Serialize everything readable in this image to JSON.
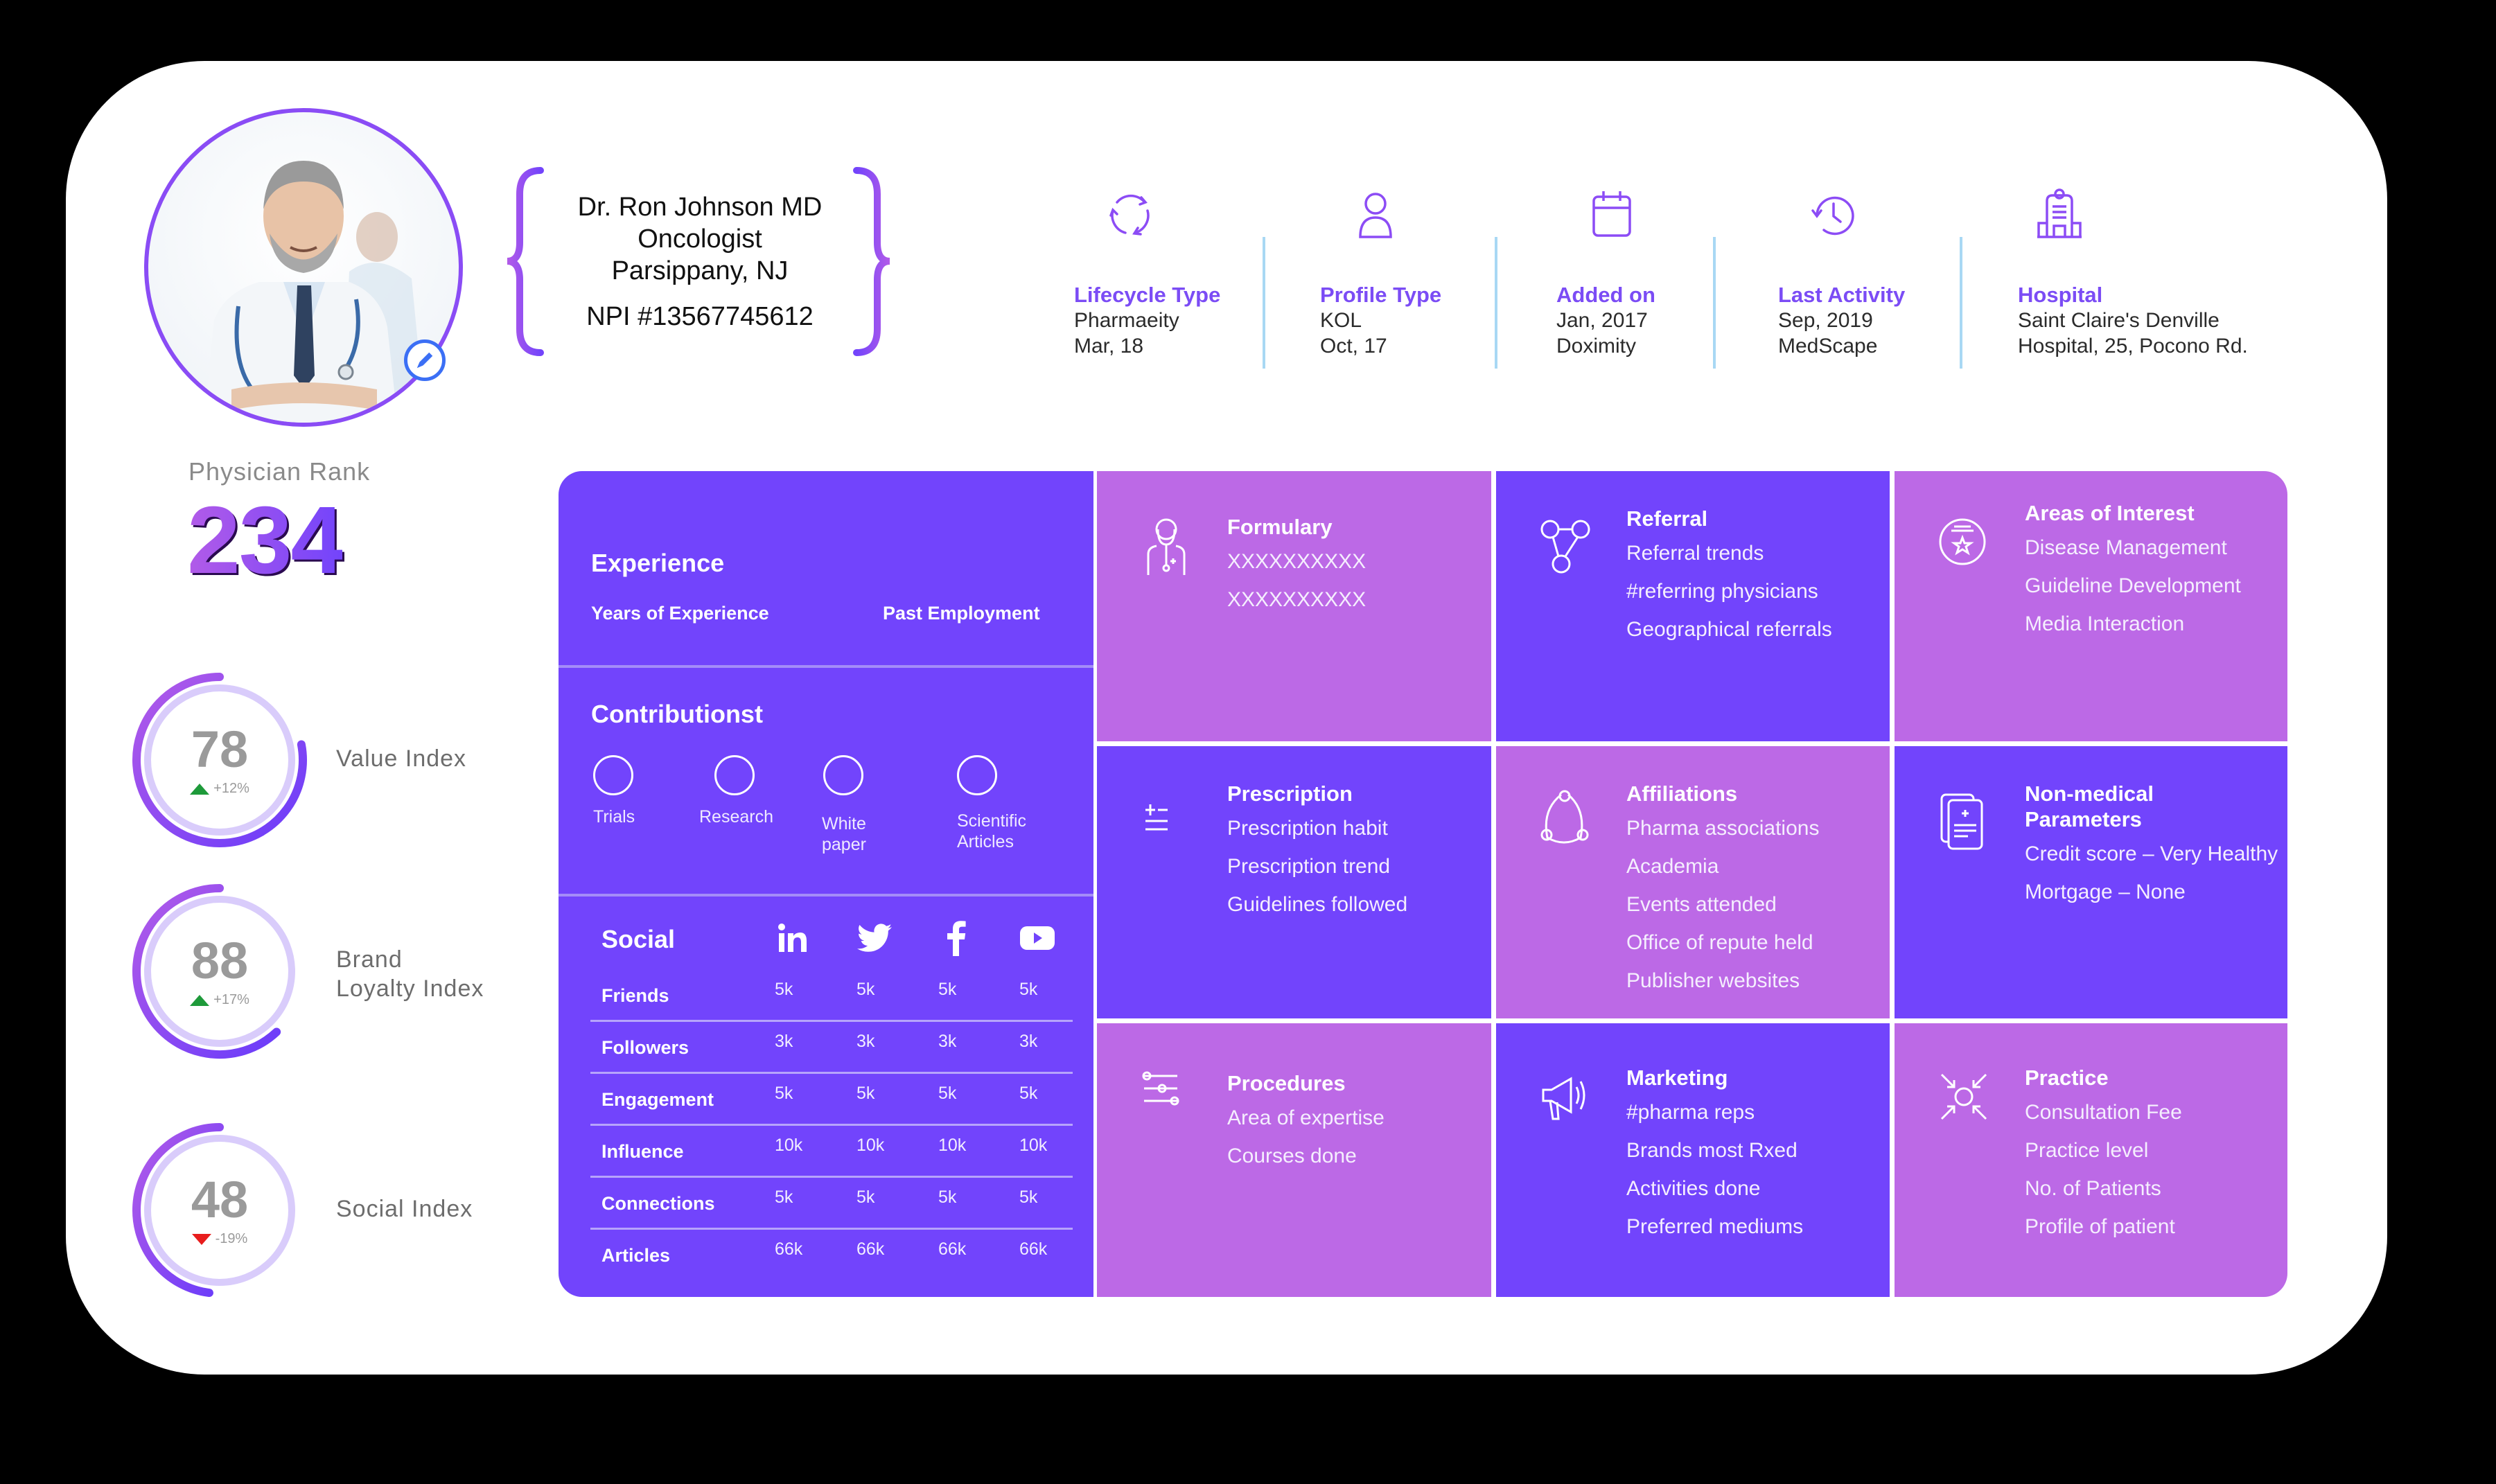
{
  "colors": {
    "primary": "#7244FC",
    "secondary": "#BC69E6",
    "accent_text": "#7B4CF5",
    "divider": "#A8D8F4",
    "up": "#1E9A3A",
    "down": "#E81D1D"
  },
  "profile": {
    "name": "Dr. Ron Johnson MD",
    "specialty": "Oncologist",
    "location": "Parsippany, NJ",
    "npi": "NPI #13567745612",
    "edit_icon": "pencil-icon"
  },
  "info": [
    {
      "icon": "cycle-icon",
      "label": "Lifecycle Type",
      "line1": "Pharmaeity",
      "line2": "Mar, 18"
    },
    {
      "icon": "user-icon",
      "label": "Profile Type",
      "line1": "KOL",
      "line2": "Oct, 17"
    },
    {
      "icon": "calendar-icon",
      "label": "Added on",
      "line1": "Jan, 2017",
      "line2": "Doximity"
    },
    {
      "icon": "history-clock-icon",
      "label": "Last Activity",
      "line1": "Sep, 2019",
      "line2": "MedScape"
    },
    {
      "icon": "hospital-icon",
      "label": "Hospital",
      "line1": "Saint Claire's Denville",
      "line2": "Hospital, 25, Pocono Rd."
    }
  ],
  "rank": {
    "label": "Physician Rank",
    "value": "234"
  },
  "indices": [
    {
      "value": "78",
      "delta": "+12%",
      "direction": "up",
      "label1": "Value Index",
      "label2": "",
      "fill": 0.78
    },
    {
      "value": "88",
      "delta": "+17%",
      "direction": "up",
      "label1": "Brand",
      "label2": "Loyalty Index",
      "fill": 0.62
    },
    {
      "value": "48",
      "delta": "-19%",
      "direction": "down",
      "label1": "Social Index",
      "label2": "",
      "fill": 0.48
    }
  ],
  "experience": {
    "title": "Experience",
    "col1": "Years of Experience",
    "col2": "Past Employment"
  },
  "contributions": {
    "title": "Contributionst",
    "items": [
      {
        "l1": "Trials",
        "l2": ""
      },
      {
        "l1": "Research",
        "l2": ""
      },
      {
        "l1": "White",
        "l2": "paper"
      },
      {
        "l1": "Scientific",
        "l2": "Articles"
      }
    ]
  },
  "social": {
    "title": "Social",
    "networks": [
      "linkedin-icon",
      "twitter-icon",
      "facebook-icon",
      "youtube-icon"
    ],
    "rows": [
      {
        "label": "Friends",
        "values": [
          "5k",
          "5k",
          "5k",
          "5k"
        ]
      },
      {
        "label": "Followers",
        "values": [
          "3k",
          "3k",
          "3k",
          "3k"
        ]
      },
      {
        "label": "Engagement",
        "values": [
          "5k",
          "5k",
          "5k",
          "5k"
        ]
      },
      {
        "label": "Influence",
        "values": [
          "10k",
          "10k",
          "10k",
          "10k"
        ]
      },
      {
        "label": "Connections",
        "values": [
          "5k",
          "5k",
          "5k",
          "5k"
        ]
      },
      {
        "label": "Articles",
        "values": [
          "66k",
          "66k",
          "66k",
          "66k"
        ]
      }
    ]
  },
  "tiles": [
    {
      "icon": "doctor-stethoscope-icon",
      "title": "Formulary",
      "items": [
        "XXXXXXXXXX",
        "XXXXXXXXXX"
      ]
    },
    {
      "icon": "referral-network-icon",
      "title": "Referral",
      "items": [
        "Referral trends",
        "#referring physicians",
        "Geographical referrals"
      ]
    },
    {
      "icon": "star-badge-icon",
      "title": "Areas of Interest",
      "items": [
        "Disease Management",
        "Guideline Development",
        "Media Interaction"
      ]
    },
    {
      "icon": "plus-minus-icon",
      "title": "Prescription",
      "items": [
        "Prescription habit",
        "Prescription trend",
        "Guidelines followed"
      ]
    },
    {
      "icon": "affiliation-circle-icon",
      "title": "Affiliations",
      "items": [
        "Pharma associations",
        "Academia",
        "Events attended",
        "Office of repute held",
        "Publisher websites"
      ]
    },
    {
      "icon": "medical-documents-icon",
      "title": "Non-medical Parameters",
      "items": [
        "Credit score – Very Healthy",
        "Mortgage – None"
      ]
    },
    {
      "icon": "sliders-icon",
      "title": "Procedures",
      "items": [
        "Area of expertise",
        "Courses done"
      ]
    },
    {
      "icon": "megaphone-icon",
      "title": "Marketing",
      "items": [
        "#pharma reps",
        "Brands most Rxed",
        "Activities done",
        "Preferred mediums"
      ]
    },
    {
      "icon": "focus-arrows-icon",
      "title": "Practice",
      "items": [
        "Consultation Fee",
        "Practice level",
        "No. of Patients",
        "Profile of patient"
      ]
    }
  ]
}
